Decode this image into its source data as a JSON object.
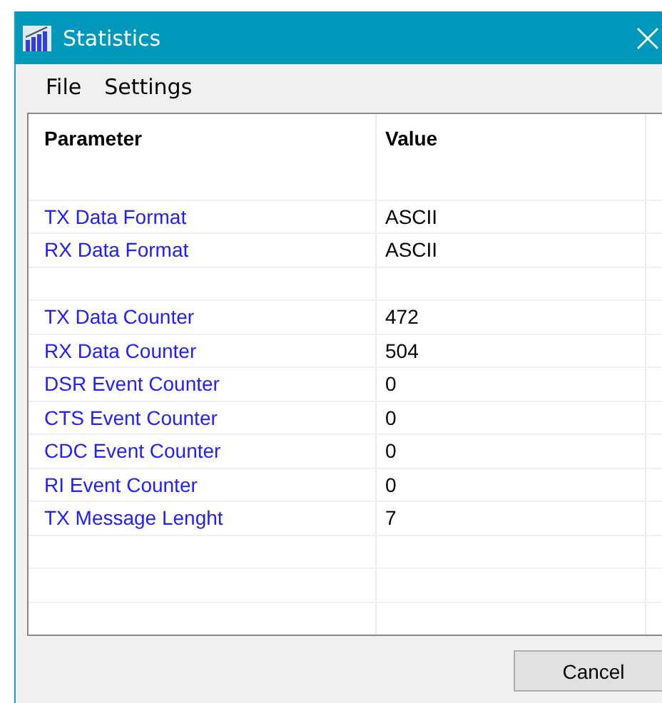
{
  "window": {
    "title": "Statistics"
  },
  "menu": [
    "File",
    "Settings"
  ],
  "table": {
    "columns": [
      "Parameter",
      "Value"
    ],
    "rows": [
      {
        "kind": "blank"
      },
      {
        "kind": "data",
        "parameter": "TX Data Format",
        "value": "ASCII"
      },
      {
        "kind": "data",
        "parameter": "RX Data Format",
        "value": "ASCII"
      },
      {
        "kind": "blank"
      },
      {
        "kind": "data",
        "parameter": "TX Data Counter",
        "value": "472"
      },
      {
        "kind": "data",
        "parameter": "RX Data Counter",
        "value": "504"
      },
      {
        "kind": "data",
        "parameter": "DSR Event Counter",
        "value": "0"
      },
      {
        "kind": "data",
        "parameter": "CTS Event Counter",
        "value": "0"
      },
      {
        "kind": "data",
        "parameter": "CDC Event Counter",
        "value": "0"
      },
      {
        "kind": "data",
        "parameter": "RI Event Counter",
        "value": "0"
      },
      {
        "kind": "data",
        "parameter": "TX Message Lenght",
        "value": "7"
      },
      {
        "kind": "blank"
      },
      {
        "kind": "blank"
      },
      {
        "kind": "blank"
      }
    ]
  },
  "buttons": [
    "Cancel"
  ]
}
